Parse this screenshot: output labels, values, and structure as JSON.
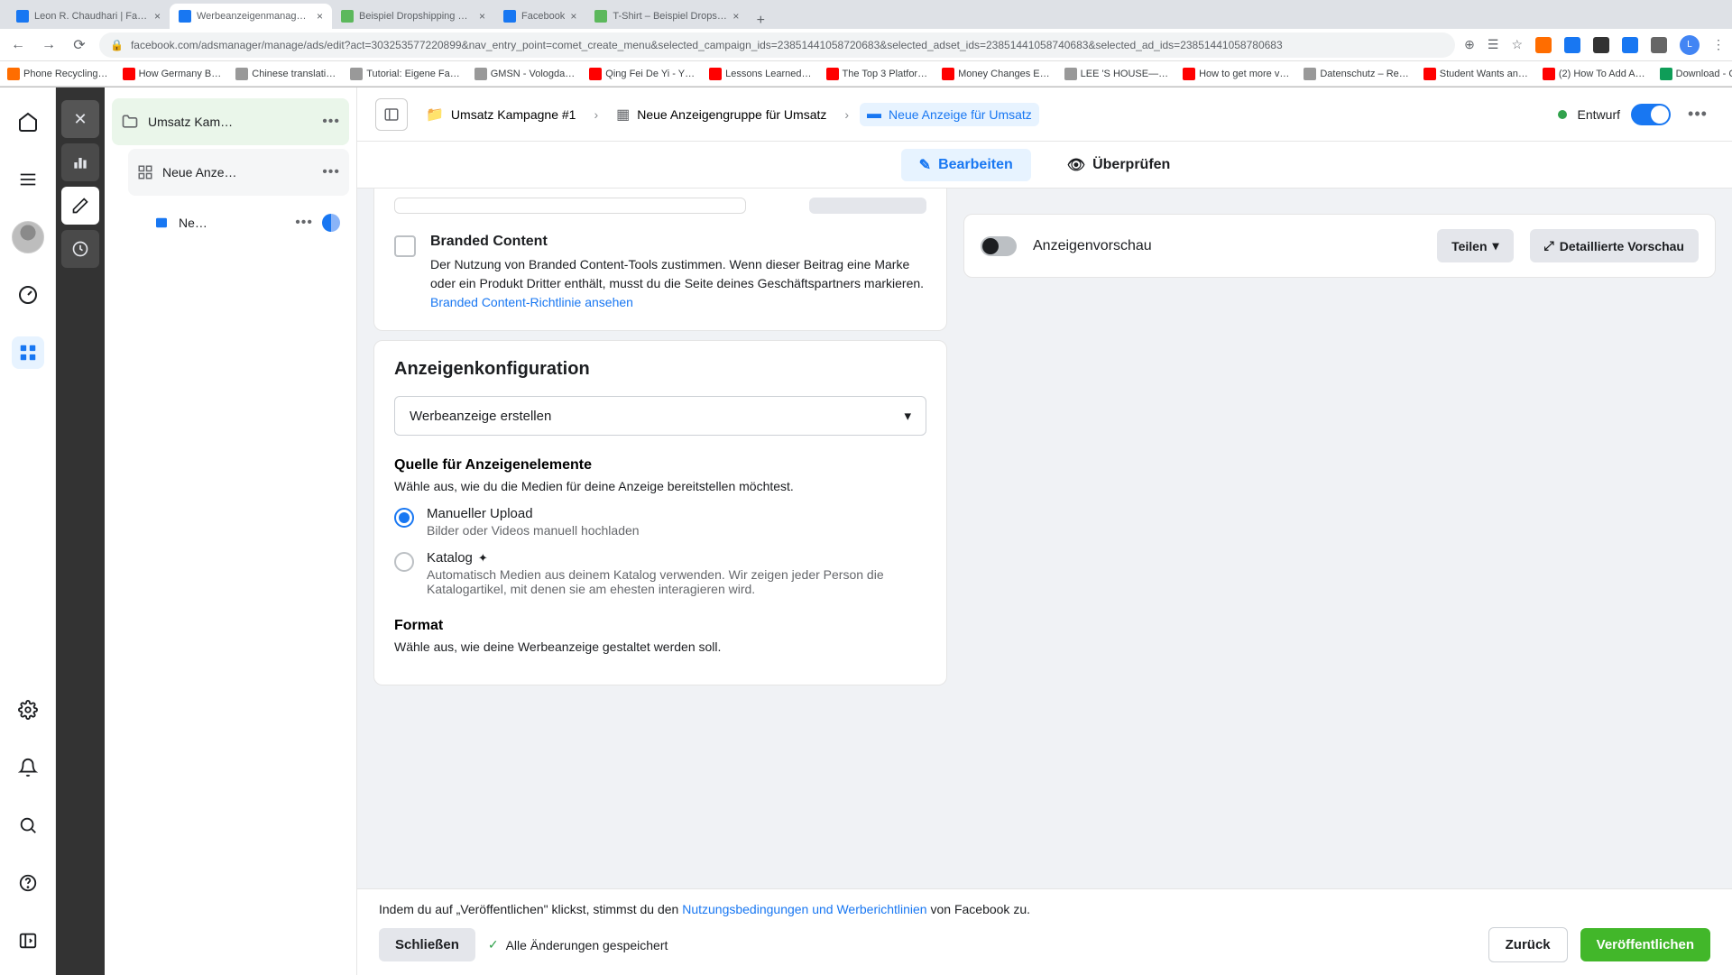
{
  "browser": {
    "tabs": [
      {
        "title": "Leon R. Chaudhari | Facebook"
      },
      {
        "title": "Werbeanzeigenmanager - We"
      },
      {
        "title": "Beispiel Dropshipping Store -"
      },
      {
        "title": "Facebook"
      },
      {
        "title": "T-Shirt – Beispiel Dropshippin"
      }
    ],
    "url": "facebook.com/adsmanager/manage/ads/edit?act=303253577220899&nav_entry_point=comet_create_menu&selected_campaign_ids=23851441058720683&selected_adset_ids=23851441058740683&selected_ad_ids=23851441058780683",
    "bookmarks": [
      "Phone Recycling…",
      "How Germany B…",
      "Chinese translati…",
      "Tutorial: Eigene Fa…",
      "GMSN - Vologda…",
      "Qing Fei De Yi - Y…",
      "Lessons Learned…",
      "The Top 3 Platfor…",
      "Money Changes E…",
      "LEE 'S HOUSE—…",
      "How to get more v…",
      "Datenschutz – Re…",
      "Student Wants an…",
      "(2) How To Add A…",
      "Download - Cooki…"
    ]
  },
  "tree": {
    "campaign": "Umsatz Kam…",
    "adset": "Neue Anze…",
    "ad": "Ne…",
    "more": "•••"
  },
  "breadcrumb": {
    "campaign": "Umsatz Kampagne #1",
    "adset": "Neue Anzeigengruppe für Umsatz",
    "ad": "Neue Anzeige für Umsatz",
    "status": "Entwurf"
  },
  "tabs": {
    "edit": "Bearbeiten",
    "review": "Überprüfen"
  },
  "branded": {
    "title": "Branded Content",
    "desc": "Der Nutzung von Branded Content-Tools zustimmen. Wenn dieser Beitrag eine Marke oder ein Produkt Dritter enthält, musst du die Seite deines Geschäftspartners markieren. ",
    "link": "Branded Content-Richtlinie ansehen"
  },
  "config": {
    "title": "Anzeigenkonfiguration",
    "select": "Werbeanzeige erstellen",
    "source_title": "Quelle für Anzeigenelemente",
    "source_desc": "Wähle aus, wie du die Medien für deine Anzeige bereitstellen möchtest.",
    "manual_label": "Manueller Upload",
    "manual_desc": "Bilder oder Videos manuell hochladen",
    "catalog_label": "Katalog",
    "catalog_desc": "Automatisch Medien aus deinem Katalog verwenden. Wir zeigen jeder Person die Katalogartikel, mit denen sie am ehesten interagieren wird.",
    "format_title": "Format",
    "format_desc": "Wähle aus, wie deine Werbeanzeige gestaltet werden soll."
  },
  "preview": {
    "label": "Anzeigenvorschau",
    "share": "Teilen",
    "detail": "Detaillierte Vorschau"
  },
  "footer": {
    "terms_pre": "Indem du auf „Veröffentlichen\" klickst, stimmst du den ",
    "terms_link": "Nutzungsbedingungen und Werberichtlinien",
    "terms_post": " von Facebook zu.",
    "close": "Schließen",
    "saved": "Alle Änderungen gespeichert",
    "back": "Zurück",
    "publish": "Veröffentlichen"
  }
}
